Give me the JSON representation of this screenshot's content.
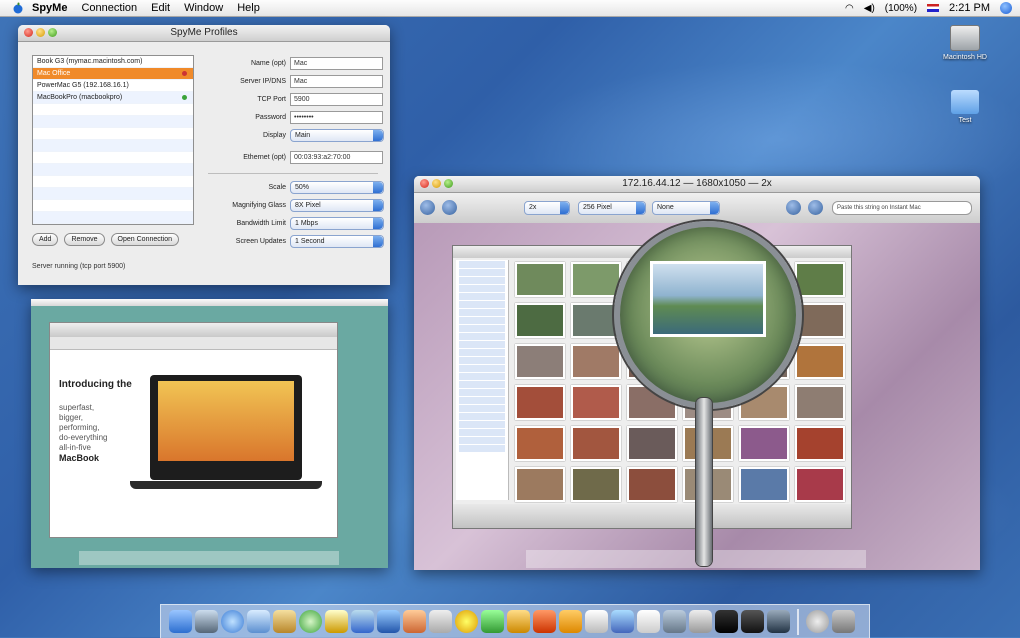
{
  "menubar": {
    "app": "SpyMe",
    "items": [
      "Connection",
      "Edit",
      "Window",
      "Help"
    ],
    "battery": "(100%)",
    "clock": "2:21 PM"
  },
  "profiles_window": {
    "title": "SpyMe Profiles",
    "list": [
      "Book G3 (mymac.macintosh.com)",
      "Mac Office",
      "PowerMac G5 (192.168.16.1)",
      "MacBookPro (macbookpro)"
    ],
    "selected_index": 1,
    "fields": [
      {
        "label": "Name (opt)",
        "value": "Mac"
      },
      {
        "label": "Server IP/DNS",
        "value": "Mac"
      },
      {
        "label": "TCP Port",
        "value": "5900"
      },
      {
        "label": "Password",
        "value": "••••••••"
      },
      {
        "label": "Display",
        "value": "Main"
      },
      {
        "label": "Ethernet (opt)",
        "value": "00:03:93:a2:70:00"
      }
    ],
    "settings": [
      {
        "label": "Scale",
        "value": "50%"
      },
      {
        "label": "Magnifying Glass",
        "value": "8X Pixel"
      },
      {
        "label": "Bandwidth Limit",
        "value": "1 Mbps"
      },
      {
        "label": "Screen Updates",
        "value": "1 Second"
      }
    ],
    "buttons": {
      "add": "Add",
      "remove": "Remove",
      "open": "Open Connection"
    },
    "status": "Server running (tcp port 5900)"
  },
  "mini_window": {
    "headline_lines": [
      "Introducing the",
      "MacBook"
    ],
    "sub_lines": [
      "superfast,",
      "bigger,",
      "performing,",
      "do-everything",
      "all-in-five"
    ]
  },
  "viewer_window": {
    "title": "172.16.44.12 — 1680x1050 — 2x",
    "zoom": "2x",
    "pixel_mode": "256 Pixel",
    "option": "None",
    "search_placeholder": "Paste this string on Instant Mac"
  },
  "desktop_icons": {
    "hd": "Macintosh HD",
    "folder": "Test"
  },
  "colors": {
    "selection": "#f08a2a",
    "accent": "#2f6fd2"
  }
}
